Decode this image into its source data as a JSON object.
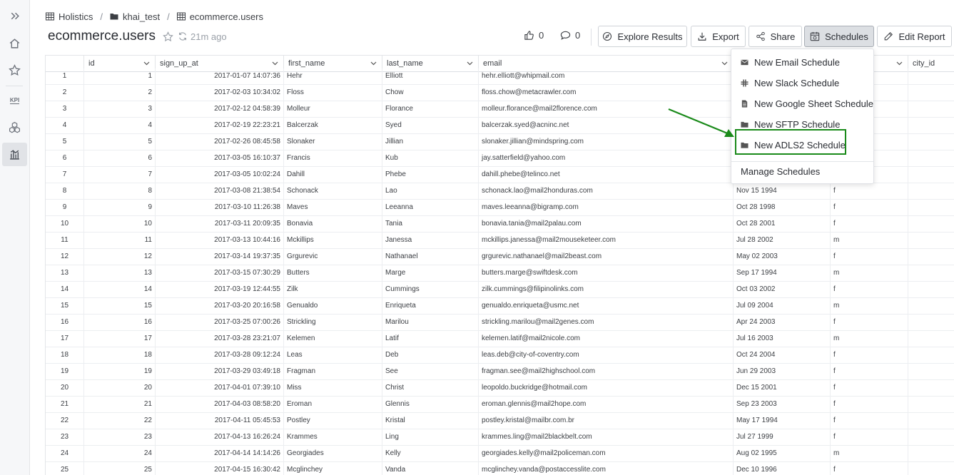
{
  "breadcrumb": {
    "items": [
      {
        "label": "Holistics",
        "icon": "table-icon"
      },
      {
        "label": "khai_test",
        "icon": "folder-icon"
      },
      {
        "label": "ecommerce.users",
        "icon": "table-icon"
      }
    ]
  },
  "header": {
    "title": "ecommerce.users",
    "updated_ago": "21m ago",
    "likes": "0",
    "comments": "0"
  },
  "toolbar": {
    "explore_label": "Explore Results",
    "export_label": "Export",
    "share_label": "Share",
    "schedules_label": "Schedules",
    "edit_label": "Edit Report"
  },
  "rail": {
    "kpi_label": "KPI"
  },
  "table": {
    "columns": [
      "id",
      "sign_up_at",
      "first_name",
      "last_name",
      "email",
      "city_id"
    ],
    "rows": [
      {
        "n": "1",
        "id": "1",
        "sign_up_at": "2017-01-07 14:07:36",
        "first_name": "Hehr",
        "last_name": "Elliott",
        "email": "hehr.elliott@whipmail.com",
        "birth": "",
        "gender": ""
      },
      {
        "n": "2",
        "id": "2",
        "sign_up_at": "2017-02-03 10:34:02",
        "first_name": "Floss",
        "last_name": "Chow",
        "email": "floss.chow@metacrawler.com",
        "birth": "",
        "gender": ""
      },
      {
        "n": "3",
        "id": "3",
        "sign_up_at": "2017-02-12 04:58:39",
        "first_name": "Molleur",
        "last_name": "Florance",
        "email": "molleur.florance@mail2florence.com",
        "birth": "",
        "gender": ""
      },
      {
        "n": "4",
        "id": "4",
        "sign_up_at": "2017-02-19 22:23:21",
        "first_name": "Balcerzak",
        "last_name": "Syed",
        "email": "balcerzak.syed@acninc.net",
        "birth": "",
        "gender": ""
      },
      {
        "n": "5",
        "id": "5",
        "sign_up_at": "2017-02-26 08:45:58",
        "first_name": "Slonaker",
        "last_name": "Jillian",
        "email": "slonaker.jillian@mindspring.com",
        "birth": "",
        "gender": ""
      },
      {
        "n": "6",
        "id": "6",
        "sign_up_at": "2017-03-05 16:10:37",
        "first_name": "Francis",
        "last_name": "Kub",
        "email": "jay.satterfield@yahoo.com",
        "birth": "",
        "gender": ""
      },
      {
        "n": "7",
        "id": "7",
        "sign_up_at": "2017-03-05 10:02:24",
        "first_name": "Dahill",
        "last_name": "Phebe",
        "email": "dahill.phebe@telinco.net",
        "birth": "",
        "gender": ""
      },
      {
        "n": "8",
        "id": "8",
        "sign_up_at": "2017-03-08 21:38:54",
        "first_name": "Schonack",
        "last_name": "Lao",
        "email": "schonack.lao@mail2honduras.com",
        "birth": "Nov 15 1994",
        "gender": "f"
      },
      {
        "n": "9",
        "id": "9",
        "sign_up_at": "2017-03-10 11:26:38",
        "first_name": "Maves",
        "last_name": "Leeanna",
        "email": "maves.leeanna@bigramp.com",
        "birth": "Oct 28 1998",
        "gender": "f"
      },
      {
        "n": "10",
        "id": "10",
        "sign_up_at": "2017-03-11 20:09:35",
        "first_name": "Bonavia",
        "last_name": "Tania",
        "email": "bonavia.tania@mail2palau.com",
        "birth": "Oct 28 2001",
        "gender": "f"
      },
      {
        "n": "11",
        "id": "11",
        "sign_up_at": "2017-03-13 10:44:16",
        "first_name": "Mckillips",
        "last_name": "Janessa",
        "email": "mckillips.janessa@mail2mouseketeer.com",
        "birth": "Jul 28 2002",
        "gender": "m"
      },
      {
        "n": "12",
        "id": "12",
        "sign_up_at": "2017-03-14 19:37:35",
        "first_name": "Grgurevic",
        "last_name": "Nathanael",
        "email": "grgurevic.nathanael@mail2beast.com",
        "birth": "May 02 2003",
        "gender": "f"
      },
      {
        "n": "13",
        "id": "13",
        "sign_up_at": "2017-03-15 07:30:29",
        "first_name": "Butters",
        "last_name": "Marge",
        "email": "butters.marge@swiftdesk.com",
        "birth": "Sep 17 1994",
        "gender": "m"
      },
      {
        "n": "14",
        "id": "14",
        "sign_up_at": "2017-03-19 12:44:55",
        "first_name": "Zilk",
        "last_name": "Cummings",
        "email": "zilk.cummings@filipinolinks.com",
        "birth": "Oct 03 2002",
        "gender": "f"
      },
      {
        "n": "15",
        "id": "15",
        "sign_up_at": "2017-03-20 20:16:58",
        "first_name": "Genualdo",
        "last_name": "Enriqueta",
        "email": "genualdo.enriqueta@usmc.net",
        "birth": "Jul 09 2004",
        "gender": "m"
      },
      {
        "n": "16",
        "id": "16",
        "sign_up_at": "2017-03-25 07:00:26",
        "first_name": "Strickling",
        "last_name": "Marilou",
        "email": "strickling.marilou@mail2genes.com",
        "birth": "Apr 24 2003",
        "gender": "f"
      },
      {
        "n": "17",
        "id": "17",
        "sign_up_at": "2017-03-28 23:21:07",
        "first_name": "Kelemen",
        "last_name": "Latif",
        "email": "kelemen.latif@mail2nicole.com",
        "birth": "Jul 16 2003",
        "gender": "m"
      },
      {
        "n": "18",
        "id": "18",
        "sign_up_at": "2017-03-28 09:12:24",
        "first_name": "Leas",
        "last_name": "Deb",
        "email": "leas.deb@city-of-coventry.com",
        "birth": "Oct 24 2004",
        "gender": "f"
      },
      {
        "n": "19",
        "id": "19",
        "sign_up_at": "2017-03-29 03:49:18",
        "first_name": "Fragman",
        "last_name": "See",
        "email": "fragman.see@mail2highschool.com",
        "birth": "Jun 29 2003",
        "gender": "f"
      },
      {
        "n": "20",
        "id": "20",
        "sign_up_at": "2017-04-01 07:39:10",
        "first_name": "Miss",
        "last_name": "Christ",
        "email": "leopoldo.buckridge@hotmail.com",
        "birth": "Dec 15 2001",
        "gender": "f"
      },
      {
        "n": "21",
        "id": "21",
        "sign_up_at": "2017-04-03 08:58:20",
        "first_name": "Eroman",
        "last_name": "Glennis",
        "email": "eroman.glennis@mail2hope.com",
        "birth": "Sep 23 2003",
        "gender": "f"
      },
      {
        "n": "22",
        "id": "22",
        "sign_up_at": "2017-04-11 05:45:53",
        "first_name": "Postley",
        "last_name": "Kristal",
        "email": "postley.kristal@mailbr.com.br",
        "birth": "May 17 1994",
        "gender": "f"
      },
      {
        "n": "23",
        "id": "23",
        "sign_up_at": "2017-04-13 16:26:24",
        "first_name": "Krammes",
        "last_name": "Ling",
        "email": "krammes.ling@mail2blackbelt.com",
        "birth": "Jul 27 1999",
        "gender": "f"
      },
      {
        "n": "24",
        "id": "24",
        "sign_up_at": "2017-04-14 14:14:26",
        "first_name": "Georgiades",
        "last_name": "Kelly",
        "email": "georgiades.kelly@mail2policeman.com",
        "birth": "Aug 02 1995",
        "gender": "m"
      },
      {
        "n": "25",
        "id": "25",
        "sign_up_at": "2017-04-15 16:30:42",
        "first_name": "Mcglinchey",
        "last_name": "Vanda",
        "email": "mcglinchey.vanda@postaccesslite.com",
        "birth": "Dec 10 1996",
        "gender": "f"
      }
    ]
  },
  "schedules_menu": {
    "items": [
      {
        "label": "New Email Schedule",
        "icon": "envelope-icon"
      },
      {
        "label": "New Slack Schedule",
        "icon": "slack-icon"
      },
      {
        "label": "New Google Sheet Schedule",
        "icon": "sheet-icon"
      },
      {
        "label": "New SFTP Schedule",
        "icon": "folder-icon"
      },
      {
        "label": "New ADLS2 Schedule",
        "icon": "folder-icon"
      }
    ],
    "manage_label": "Manage Schedules"
  },
  "colors": {
    "highlight": "#1a8a1a",
    "active_button": "#dcdfe3"
  }
}
